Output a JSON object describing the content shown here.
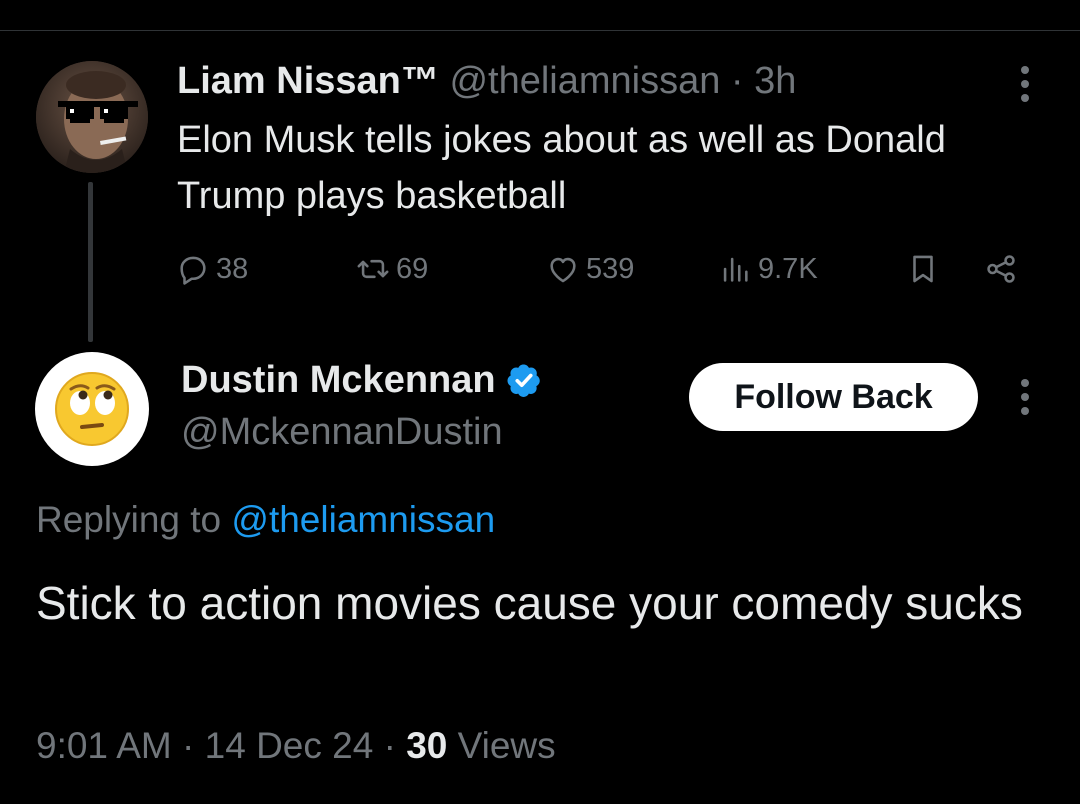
{
  "parent_tweet": {
    "author_name": "Liam Nissan™",
    "author_handle": "@theliamnissan",
    "separator": "·",
    "time_ago": "3h",
    "text": "Elon Musk tells jokes about as well as Donald Trump plays basketball",
    "stats": {
      "replies": "38",
      "reposts": "69",
      "likes": "539",
      "views": "9.7K"
    },
    "icons": [
      "reply-icon",
      "repost-icon",
      "like-icon",
      "views-icon",
      "bookmark-icon",
      "share-icon",
      "more-icon"
    ]
  },
  "reply_tweet": {
    "author_name": "Dustin Mckennan",
    "author_handle": "@MckennanDustin",
    "verified": true,
    "follow_button_label": "Follow Back",
    "replying_prefix": "Replying to",
    "replying_mention": "@theliamnissan",
    "text": "Stick to action movies cause your comedy sucks",
    "timestamp": "9:01 AM · 14 Dec 24 ·",
    "views_count": "30",
    "views_label": "Views"
  },
  "colors": {
    "background": "#000000",
    "primary_text": "#e7e9ea",
    "secondary_text": "#71767b",
    "link": "#1d9bf0",
    "verified_badge": "#1d9bf0",
    "divider": "#2f3336"
  }
}
